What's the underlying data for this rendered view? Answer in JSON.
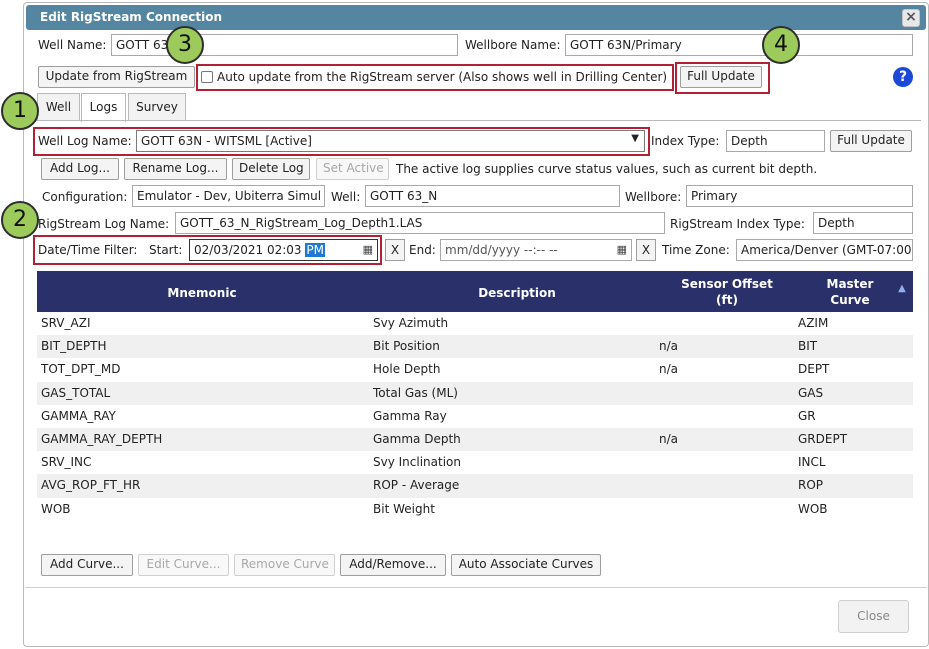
{
  "dialog": {
    "title": "Edit RigStream Connection",
    "close_glyph": "×"
  },
  "connection": {
    "well_name_label": "Well Name:",
    "well_name_value": "GOTT 63",
    "wellbore_name_label": "Wellbore Name:",
    "wellbore_name_value": "GOTT 63N/Primary",
    "update_button": "Update from RigStream",
    "auto_update_label": "Auto update from the RigStream server (Also shows well in Drilling Center)",
    "auto_update_checked": false,
    "full_update_button": "Full Update",
    "help_glyph": "?"
  },
  "tabs": [
    {
      "label": "Well",
      "active": false
    },
    {
      "label": "Logs",
      "active": true
    },
    {
      "label": "Survey",
      "active": false
    }
  ],
  "logs": {
    "well_log_name_label": "Well Log Name:",
    "well_log_name_value": "GOTT 63N - WITSML [Active]",
    "index_type_label": "Index Type:",
    "index_type_value": "Depth",
    "full_update_button": "Full Update",
    "add_log_button": "Add Log...",
    "rename_log_button": "Rename Log...",
    "delete_log_button": "Delete Log",
    "set_active_button": "Set Active",
    "active_log_note": "The active log supplies curve status values, such as current bit depth.",
    "configuration_label": "Configuration:",
    "configuration_value": "Emulator - Dev, Ubiterra Simul",
    "well_label": "Well:",
    "well_value": "GOTT 63_N",
    "wellbore_label": "Wellbore:",
    "wellbore_value": "Primary",
    "rigstream_log_name_label": "RigStream Log Name:",
    "rigstream_log_name_value": "GOTT_63_N_RigStream_Log_Depth1.LAS",
    "rigstream_index_type_label": "RigStream Index Type:",
    "rigstream_index_type_value": "Depth",
    "date_time_filter_label": "Date/Time Filter:",
    "start_label": "Start:",
    "start_value": "02/03/2021 02:03",
    "start_ampm": "PM",
    "clear_glyph": "X",
    "end_label": "End:",
    "end_placeholder": "mm/dd/yyyy --:-- --",
    "time_zone_label": "Time Zone:",
    "time_zone_value": "America/Denver (GMT-07:00)"
  },
  "table": {
    "columns": [
      "Mnemonic",
      "Description",
      "Sensor Offset (ft)",
      "Master Curve"
    ],
    "sort_glyph": "▲",
    "rows": [
      {
        "mnemonic": "SRV_AZI",
        "description": "Svy Azimuth",
        "offset": "",
        "master": "AZIM"
      },
      {
        "mnemonic": "BIT_DEPTH",
        "description": "Bit Position",
        "offset": "n/a",
        "master": "BIT"
      },
      {
        "mnemonic": "TOT_DPT_MD",
        "description": "Hole Depth",
        "offset": "n/a",
        "master": "DEPT"
      },
      {
        "mnemonic": "GAS_TOTAL",
        "description": "Total Gas (ML)",
        "offset": "",
        "master": "GAS"
      },
      {
        "mnemonic": "GAMMA_RAY",
        "description": "Gamma Ray",
        "offset": "",
        "master": "GR"
      },
      {
        "mnemonic": "GAMMA_RAY_DEPTH",
        "description": "Gamma Depth",
        "offset": "n/a",
        "master": "GRDEPT"
      },
      {
        "mnemonic": "SRV_INC",
        "description": "Svy Inclination",
        "offset": "",
        "master": "INCL"
      },
      {
        "mnemonic": "AVG_ROP_FT_HR",
        "description": "ROP - Average",
        "offset": "",
        "master": "ROP"
      },
      {
        "mnemonic": "WOB",
        "description": "Bit Weight",
        "offset": "",
        "master": "WOB"
      }
    ]
  },
  "curve_buttons": {
    "add_curve": "Add Curve...",
    "edit_curve": "Edit Curve...",
    "remove_curve": "Remove Curve",
    "add_remove": "Add/Remove...",
    "auto_associate": "Auto Associate Curves"
  },
  "footer": {
    "close_button": "Close"
  },
  "callouts": [
    "1",
    "2",
    "3",
    "4"
  ],
  "colors": {
    "titlebar": "#5586a1",
    "table_header": "#29306a",
    "callout_fill": "#9ccb5c",
    "highlight_border": "#b22033",
    "help_icon": "#1b48d6"
  }
}
